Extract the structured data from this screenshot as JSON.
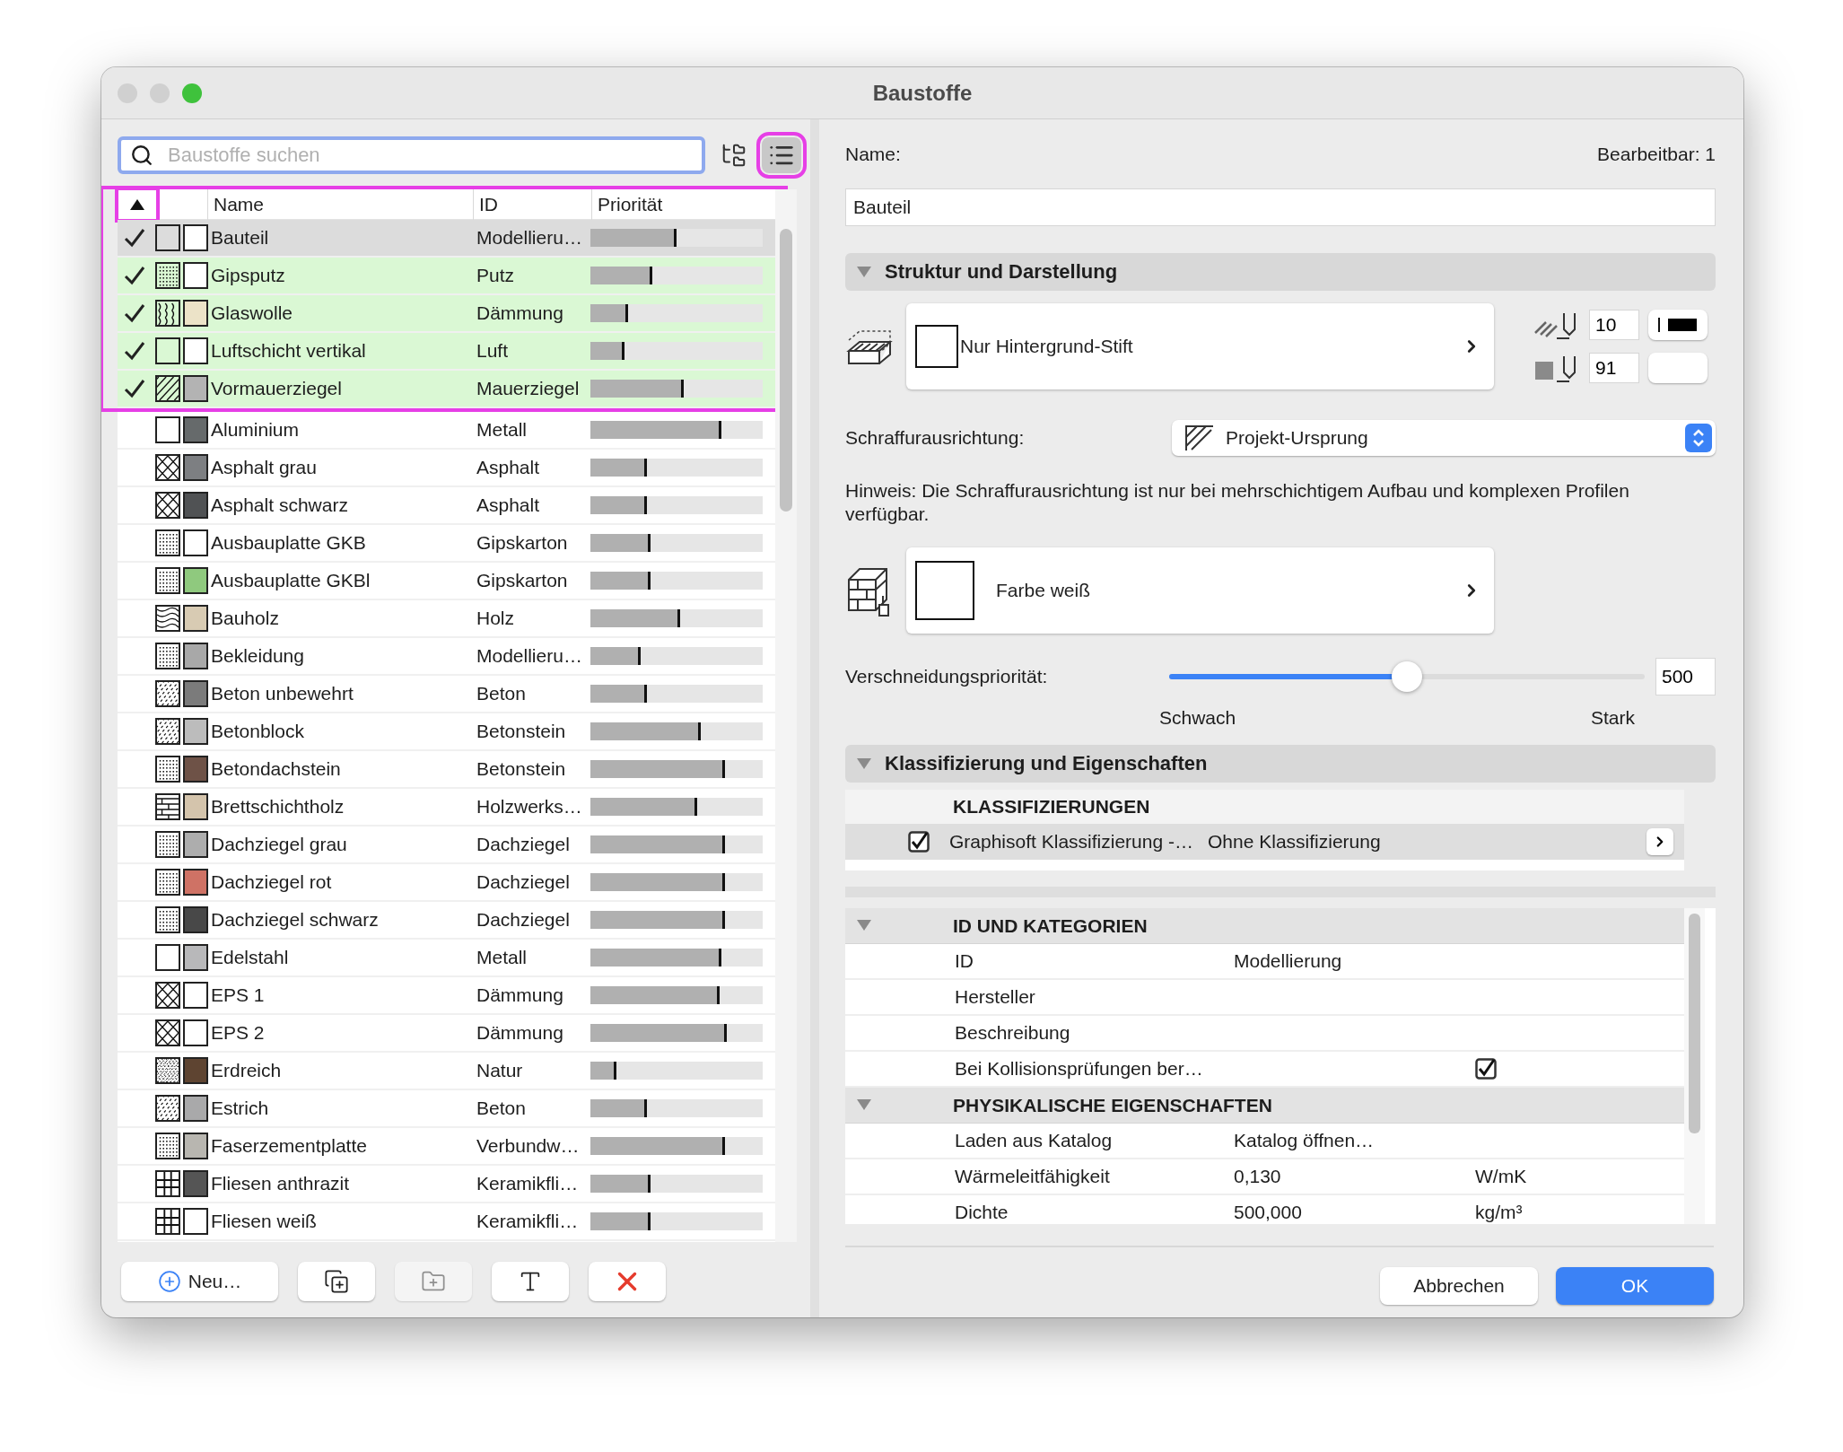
{
  "window": {
    "title": "Baustoffe"
  },
  "search": {
    "placeholder": "Baustoffe suchen"
  },
  "view_buttons": [
    {
      "kind": "tree",
      "selected": false,
      "highlighted": false
    },
    {
      "kind": "list",
      "selected": true,
      "highlighted": true
    }
  ],
  "table": {
    "sort_ascending": true,
    "sort_highlighted": true,
    "checked_rows_highlighted": true,
    "columns": [
      "Name",
      "ID",
      "Priorität"
    ],
    "rows": [
      {
        "checked": true,
        "selected": true,
        "kind": "none",
        "color": "#ffffff",
        "name": "Bauteil",
        "id": "Modellieru…",
        "level": 0.5
      },
      {
        "checked": true,
        "selected": false,
        "kind": "dots",
        "color": "#ffffff",
        "name": "Gipsputz",
        "id": "Putz",
        "level": 0.36
      },
      {
        "checked": true,
        "selected": false,
        "kind": "insulation",
        "color": "#ece3c8",
        "name": "Glaswolle",
        "id": "Dämmung",
        "level": 0.22
      },
      {
        "checked": true,
        "selected": false,
        "kind": "none",
        "color": "#ffffff",
        "name": "Luftschicht vertikal",
        "id": "Luft",
        "level": 0.2
      },
      {
        "checked": true,
        "selected": false,
        "kind": "diagonal",
        "color": "#b3b3b3",
        "name": "Vormauerziegel",
        "id": "Mauerziegel",
        "level": 0.54
      },
      {
        "checked": false,
        "selected": false,
        "kind": "none",
        "color": "#666a6b",
        "name": "Aluminium",
        "id": "Metall",
        "level": 0.76
      },
      {
        "checked": false,
        "selected": false,
        "kind": "cross",
        "color": "#7d7f82",
        "name": "Asphalt grau",
        "id": "Asphalt",
        "level": 0.33
      },
      {
        "checked": false,
        "selected": false,
        "kind": "cross",
        "color": "#505254",
        "name": "Asphalt schwarz",
        "id": "Asphalt",
        "level": 0.33
      },
      {
        "checked": false,
        "selected": false,
        "kind": "dots",
        "color": "#ffffff",
        "name": "Ausbauplatte GKB",
        "id": "Gipskarton",
        "level": 0.35
      },
      {
        "checked": false,
        "selected": false,
        "kind": "dots",
        "color": "#8fc97e",
        "name": "Ausbauplatte GKBl",
        "id": "Gipskarton",
        "level": 0.35
      },
      {
        "checked": false,
        "selected": false,
        "kind": "wood",
        "color": "#d8cbb3",
        "name": "Bauholz",
        "id": "Holz",
        "level": 0.52
      },
      {
        "checked": false,
        "selected": false,
        "kind": "dots",
        "color": "#a8a8a8",
        "name": "Bekleidung",
        "id": "Modellieru…",
        "level": 0.29
      },
      {
        "checked": false,
        "selected": false,
        "kind": "concrete",
        "color": "#7b7b7b",
        "name": "Beton unbewehrt",
        "id": "Beton",
        "level": 0.33
      },
      {
        "checked": false,
        "selected": false,
        "kind": "concrete",
        "color": "#bcbcbc",
        "name": "Betonblock",
        "id": "Betonstein",
        "level": 0.64
      },
      {
        "checked": false,
        "selected": false,
        "kind": "dots",
        "color": "#6e5247",
        "name": "Betondachstein",
        "id": "Betonstein",
        "level": 0.78
      },
      {
        "checked": false,
        "selected": false,
        "kind": "brick",
        "color": "#d4c4ac",
        "name": "Brettschichtholz",
        "id": "Holzwerks…",
        "level": 0.62
      },
      {
        "checked": false,
        "selected": false,
        "kind": "dots",
        "color": "#adadad",
        "name": "Dachziegel grau",
        "id": "Dachziegel",
        "level": 0.78
      },
      {
        "checked": false,
        "selected": false,
        "kind": "dots",
        "color": "#cf7265",
        "name": "Dachziegel rot",
        "id": "Dachziegel",
        "level": 0.78
      },
      {
        "checked": false,
        "selected": false,
        "kind": "dots",
        "color": "#484848",
        "name": "Dachziegel schwarz",
        "id": "Dachziegel",
        "level": 0.78
      },
      {
        "checked": false,
        "selected": false,
        "kind": "none",
        "color": "#b8b8ba",
        "name": "Edelstahl",
        "id": "Metall",
        "level": 0.76
      },
      {
        "checked": false,
        "selected": false,
        "kind": "cross",
        "color": "#ffffff",
        "name": "EPS 1",
        "id": "Dämmung",
        "level": 0.75
      },
      {
        "checked": false,
        "selected": false,
        "kind": "cross",
        "color": "#ffffff",
        "name": "EPS 2",
        "id": "Dämmung",
        "level": 0.79
      },
      {
        "checked": false,
        "selected": false,
        "kind": "soil",
        "color": "#5e4431",
        "name": "Erdreich",
        "id": "Natur",
        "level": 0.15
      },
      {
        "checked": false,
        "selected": false,
        "kind": "concrete",
        "color": "#a9a9aa",
        "name": "Estrich",
        "id": "Beton",
        "level": 0.33
      },
      {
        "checked": false,
        "selected": false,
        "kind": "dots",
        "color": "#b8b6b0",
        "name": "Faserzementplatte",
        "id": "Verbundw…",
        "level": 0.78
      },
      {
        "checked": false,
        "selected": false,
        "kind": "tiles",
        "color": "#555555",
        "name": "Fliesen anthrazit",
        "id": "Keramikfli…",
        "level": 0.35
      },
      {
        "checked": false,
        "selected": false,
        "kind": "tiles",
        "color": "#ffffff",
        "name": "Fliesen weiß",
        "id": "Keramikfli…",
        "level": 0.35
      }
    ]
  },
  "list_buttons": [
    {
      "kind": "new",
      "label": "Neu…",
      "disabled": false
    },
    {
      "kind": "duplicate",
      "disabled": false
    },
    {
      "kind": "import",
      "disabled": true
    },
    {
      "kind": "rename",
      "disabled": false
    },
    {
      "kind": "delete",
      "disabled": false
    }
  ],
  "details": {
    "name_label": "Name:",
    "editable": "Bearbeitbar: 1",
    "name_value": "Bauteil"
  },
  "structure": {
    "title": "Struktur und Darstellung",
    "expanded": true,
    "fill_label": "Nur Hintergrund-Stift",
    "hatch_pen": "10",
    "fill_pen": "91",
    "orientation_label": "Schraffurausrichtung:",
    "orientation_value": "Projekt-Ursprung",
    "hint": "Hinweis: Die Schraffurausrichtung ist nur bei mehrschichtigem Aufbau und komplexen Profilen verfügbar.",
    "surface_label": "Farbe weiß",
    "priority_label": "Verschneidungspriorität:",
    "priority": {
      "level": 0.5,
      "value": "500",
      "min_label": "Schwach",
      "max_label": "Stark"
    }
  },
  "classification": {
    "title": "Klassifizierung und Eigenschaften",
    "expanded": true,
    "heading": "KLASSIFIZIERUNGEN",
    "items": [
      {
        "checked": true,
        "system": "Graphisoft Klassifizierung -…",
        "value": "Ohne Klassifizierung"
      }
    ]
  },
  "properties": [
    {
      "title": "ID UND KATEGORIEN",
      "expanded": true,
      "rows": [
        {
          "kind": "text",
          "label": "ID",
          "value": "Modellierung"
        },
        {
          "kind": "text",
          "label": "Hersteller"
        },
        {
          "kind": "text",
          "label": "Beschreibung"
        },
        {
          "kind": "checkbox",
          "label": "Bei Kollisionsprüfungen ber…",
          "checked": true
        }
      ]
    },
    {
      "title": "PHYSIKALISCHE EIGENSCHAFTEN",
      "expanded": true,
      "rows": [
        {
          "kind": "text",
          "label": "Laden aus Katalog",
          "value": "Katalog öffnen…"
        },
        {
          "kind": "text",
          "label": "Wärmeleitfähigkeit",
          "value": "0,130",
          "unit": "W/mK"
        },
        {
          "kind": "text",
          "label": "Dichte",
          "value": "500,000",
          "unit": "kg/m³"
        }
      ]
    }
  ],
  "footer_buttons": [
    {
      "label": "Abbrechen",
      "primary": false
    },
    {
      "label": "OK",
      "primary": true
    }
  ]
}
